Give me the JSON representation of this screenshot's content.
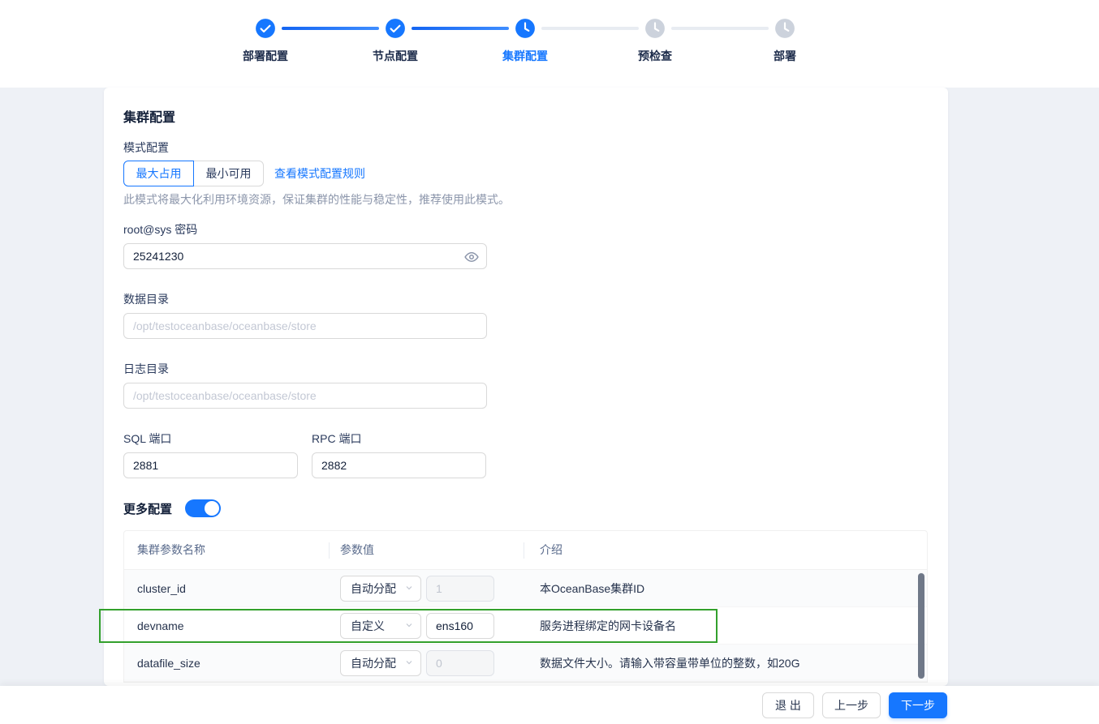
{
  "colors": {
    "accent": "#1677ff",
    "highlight_border": "#33a02c",
    "page_band": "#eef1f6",
    "pending_step": "#ccd2dc"
  },
  "icons": {
    "step_done": "check-circle-icon",
    "step_progress": "clock-icon",
    "password_visibility": "eye-icon",
    "select_caret": "chevron-down-icon"
  },
  "stepper": {
    "steps": [
      {
        "label": "部署配置",
        "state": "done"
      },
      {
        "label": "节点配置",
        "state": "done"
      },
      {
        "label": "集群配置",
        "state": "current"
      },
      {
        "label": "预检查",
        "state": "pending"
      },
      {
        "label": "部署",
        "state": "pending"
      }
    ]
  },
  "card": {
    "title": "集群配置",
    "mode": {
      "label": "模式配置",
      "options": [
        "最大占用",
        "最小可用"
      ],
      "selected": "最大占用",
      "link": "查看模式配置规则",
      "description": "此模式将最大化利用环境资源，保证集群的性能与稳定性，推荐使用此模式。"
    },
    "password": {
      "label": "root@sys 密码",
      "value": "25241230"
    },
    "data_dir": {
      "label": "数据目录",
      "placeholder": "/opt/testoceanbase/oceanbase/store"
    },
    "log_dir": {
      "label": "日志目录",
      "placeholder": "/opt/testoceanbase/oceanbase/store"
    },
    "sql_port": {
      "label": "SQL 端口",
      "value": "2881"
    },
    "rpc_port": {
      "label": "RPC 端口",
      "value": "2882"
    },
    "more_config": {
      "label": "更多配置",
      "enabled": true
    },
    "table": {
      "headers": [
        "集群参数名称",
        "参数值",
        "介绍"
      ],
      "rows": [
        {
          "name": "cluster_id",
          "mode": "自动分配",
          "value": "1",
          "value_disabled": true,
          "desc": "本OceanBase集群ID",
          "highlighted": false
        },
        {
          "name": "devname",
          "mode": "自定义",
          "value": "ens160",
          "value_disabled": false,
          "desc": "服务进程绑定的网卡设备名",
          "highlighted": true
        },
        {
          "name": "datafile_size",
          "mode": "自动分配",
          "value": "0",
          "value_disabled": true,
          "desc": "数据文件大小。请输入带容量带单位的整数，如20G",
          "highlighted": false
        }
      ]
    }
  },
  "footer": {
    "exit_label": "退 出",
    "prev_label": "上一步",
    "next_label": "下一步"
  }
}
